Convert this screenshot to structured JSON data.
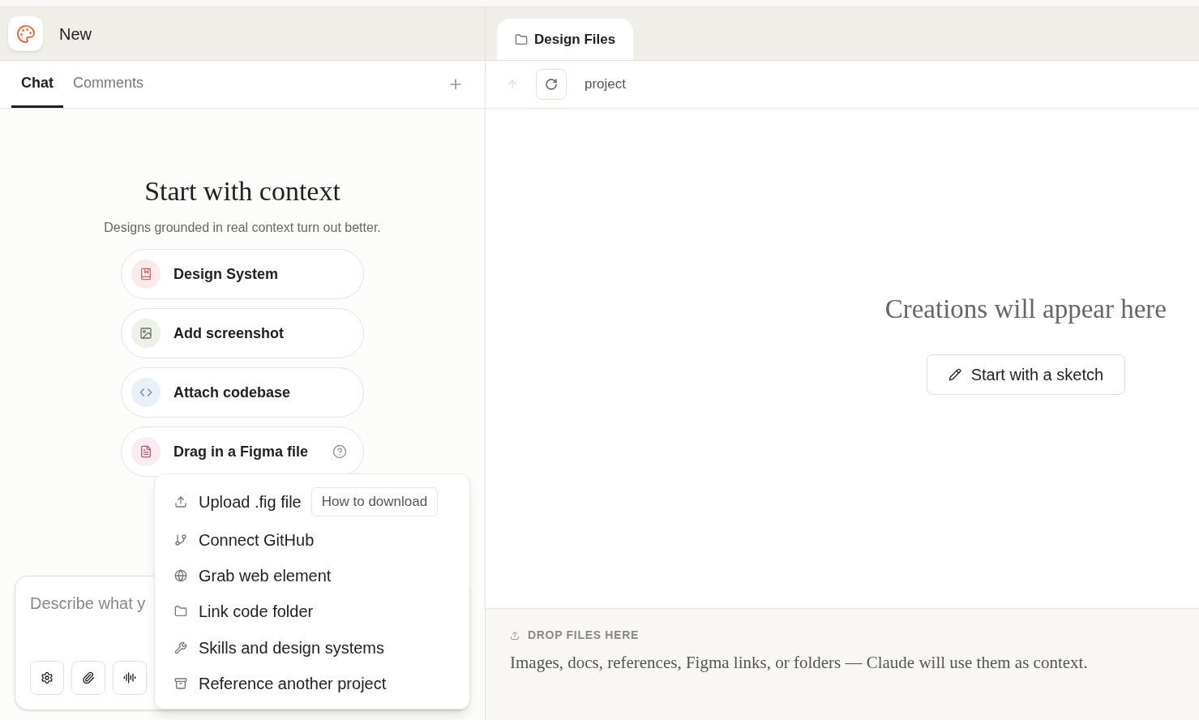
{
  "project": {
    "title": "New"
  },
  "tabs": [
    {
      "label": "Chat",
      "selected": true
    },
    {
      "label": "Comments",
      "selected": false
    }
  ],
  "context": {
    "title": "Start with context",
    "subtitle": "Designs grounded in real context turn out better.",
    "options": [
      {
        "kind": "design-system",
        "label": "Design System",
        "color": "#fbeaea"
      },
      {
        "kind": "screenshot",
        "label": "Add screenshot",
        "color": "#eef0ea"
      },
      {
        "kind": "codebase",
        "label": "Attach codebase",
        "color": "#e9f0fa"
      },
      {
        "kind": "figma",
        "label": "Drag in a Figma file",
        "color": "#fbeaf0",
        "help": true
      }
    ]
  },
  "composer": {
    "placeholder": "Describe what y"
  },
  "menu": [
    {
      "kind": "upload",
      "label": "Upload .fig file",
      "link": "How to download"
    },
    {
      "kind": "github",
      "label": "Connect GitHub"
    },
    {
      "kind": "web",
      "label": "Grab web element"
    },
    {
      "kind": "folder",
      "label": "Link code folder"
    },
    {
      "kind": "skills",
      "label": "Skills and design systems"
    },
    {
      "kind": "project",
      "label": "Reference another project"
    }
  ],
  "files_tab": {
    "label": "Design Files",
    "selected": true
  },
  "toolbar": {
    "up_disabled": true,
    "path": "project"
  },
  "canvas": {
    "title": "Creations will appear here",
    "button": "Start with a sketch"
  },
  "drop": {
    "heading": "DROP FILES HERE",
    "text": "Images, docs, references, Figma links, or folders — Claude will use them as context."
  }
}
